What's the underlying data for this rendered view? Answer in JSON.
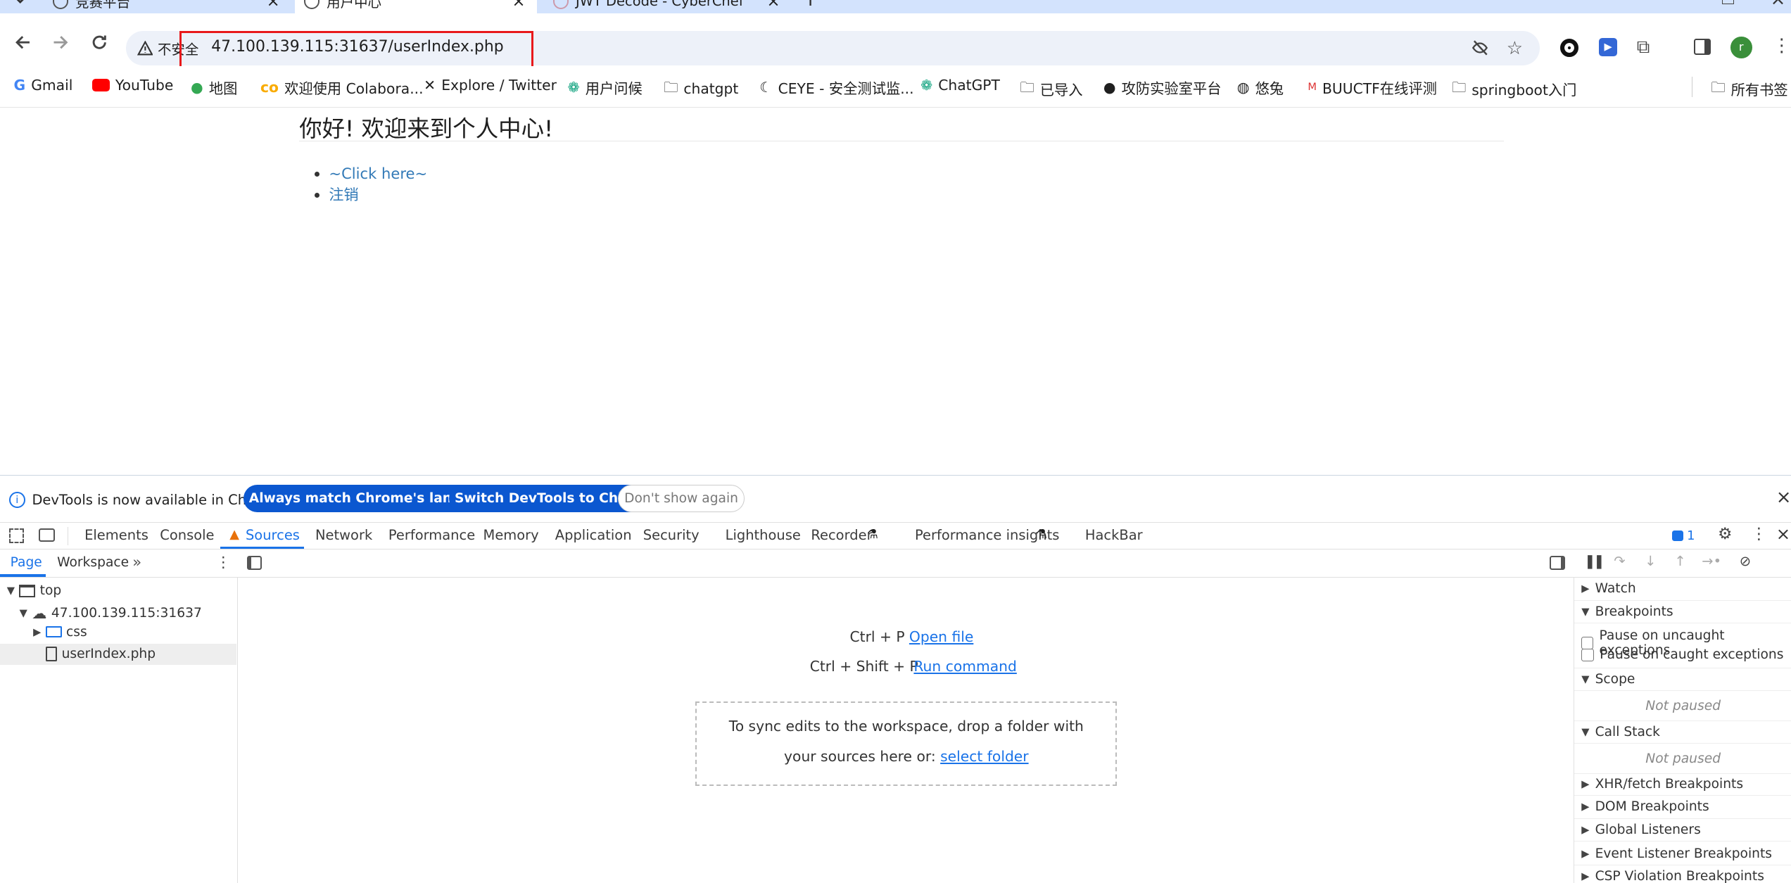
{
  "tabs": [
    {
      "title": "竞赛平台"
    },
    {
      "title": "用户中心"
    },
    {
      "title": "JWT Decode - CyberChef"
    }
  ],
  "omnibox": {
    "security_label": "不安全",
    "url": "47.100.139.115:31637/userIndex.php"
  },
  "bookmarks": {
    "items": [
      "Gmail",
      "YouTube",
      "地图",
      "欢迎使用 Colabora...",
      "Explore / Twitter",
      "用户问候",
      "chatgpt",
      "CEYE - 安全测试监...",
      "ChatGPT",
      "已导入",
      "攻防实验室平台",
      "悠兔",
      "BUUCTF在线评测",
      "springboot入门"
    ],
    "all_bookmarks": "所有书签"
  },
  "page": {
    "heading": "你好! 欢迎来到个人中心!",
    "links": [
      "~Click here~",
      "注销"
    ]
  },
  "devtools": {
    "infobar": {
      "message": "DevTools is now available in Chinese!",
      "btn_match": "Always match Chrome's language",
      "btn_switch": "Switch DevTools to Chinese",
      "btn_dismiss": "Don't show again"
    },
    "tabs": [
      "Elements",
      "Console",
      "Sources",
      "Network",
      "Performance",
      "Memory",
      "Application",
      "Security",
      "Lighthouse",
      "Recorder",
      "Performance insights",
      "HackBar"
    ],
    "issues_count": "1",
    "navigator": {
      "tab_page": "Page",
      "tab_workspace": "Workspace",
      "top": "top",
      "host": "47.100.139.115:31637",
      "folder": "css",
      "file": "userIndex.php"
    },
    "editor": {
      "shortcut1_keys": "Ctrl + P",
      "shortcut1_action": "Open file",
      "shortcut2_keys": "Ctrl + Shift + P",
      "shortcut2_action": "Run command",
      "drop_text": "To sync edits to the workspace, drop a folder with your sources here or:",
      "drop_link": "select folder"
    },
    "debugger": {
      "watch": "Watch",
      "breakpoints": "Breakpoints",
      "pause_uncaught": "Pause on uncaught exceptions",
      "pause_caught": "Pause on caught exceptions",
      "scope": "Scope",
      "scope_state": "Not paused",
      "call_stack": "Call Stack",
      "call_stack_state": "Not paused",
      "xhr": "XHR/fetch Breakpoints",
      "dom": "DOM Breakpoints",
      "global": "Global Listeners",
      "event": "Event Listener Breakpoints",
      "csp": "CSP Violation Breakpoints"
    }
  },
  "colors": {
    "accent": "#1a73e8",
    "link": "#337ab7",
    "warning": "#e8710a",
    "highlight_box": "#e8191b"
  }
}
